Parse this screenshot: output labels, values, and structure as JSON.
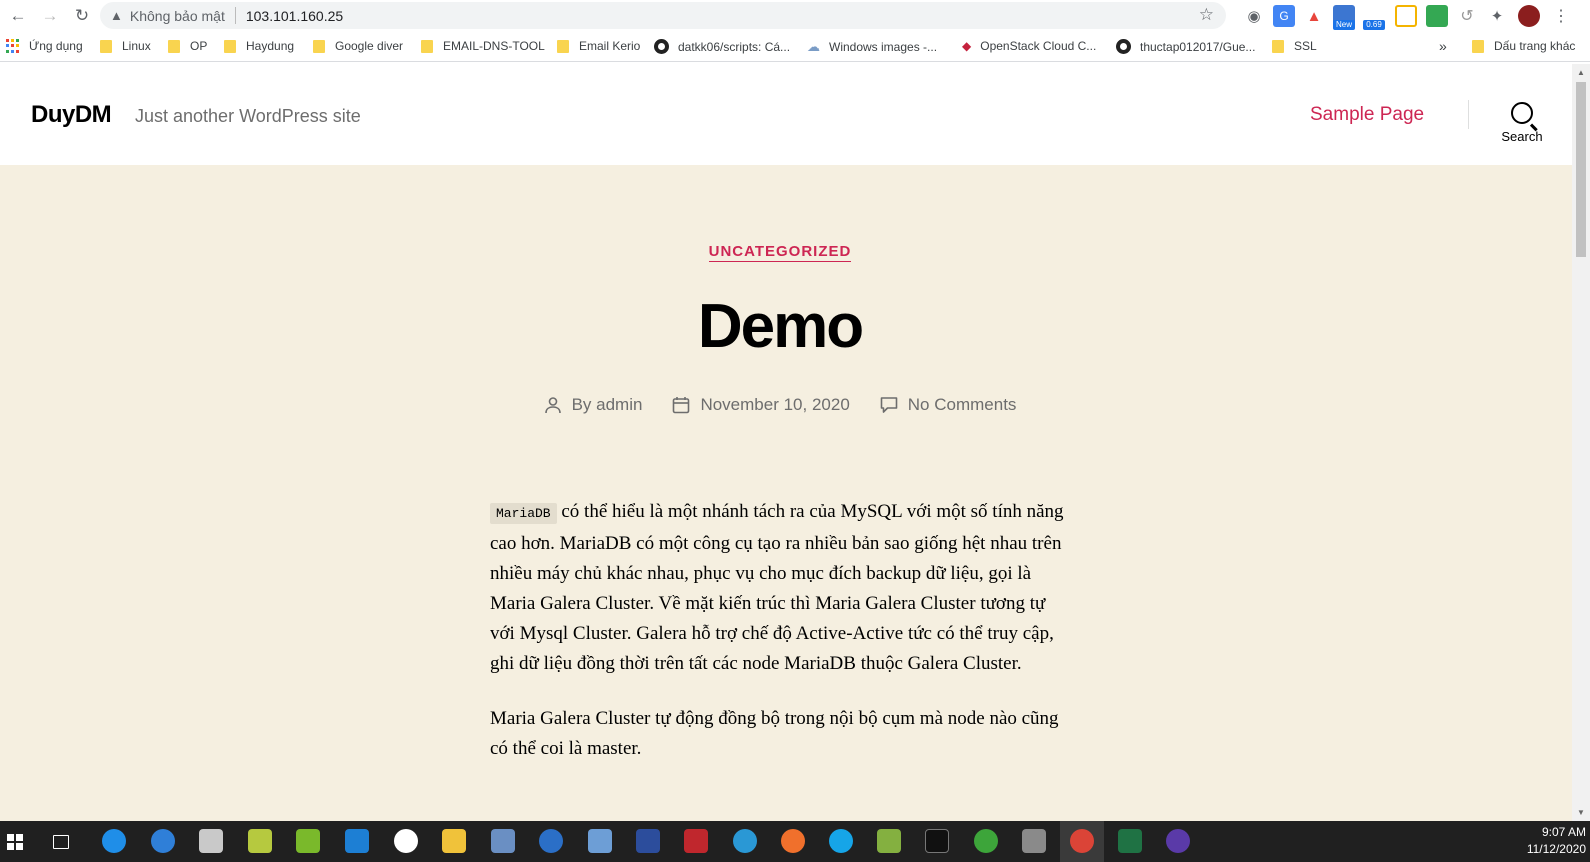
{
  "browser": {
    "security_text": "Không bảo mật",
    "url": "103.101.160.25",
    "ext_new_badge": "New",
    "ext_counter_badge": "0.69"
  },
  "bookmarks": {
    "apps": "Ứng dụng",
    "items": [
      "Linux",
      "OP",
      "Haydung",
      "Google diver",
      "EMAIL-DNS-TOOL",
      "Email Kerio",
      "datkk06/scripts: Cá...",
      "Windows images -...",
      "OpenStack Cloud C...",
      "thuctap012017/Gue...",
      "SSL"
    ],
    "overflow": "»",
    "other": "Dấu trang khác"
  },
  "site": {
    "title": "DuyDM",
    "description": "Just another WordPress site",
    "nav_item": "Sample Page",
    "search_label": "Search"
  },
  "post": {
    "category": "UNCATEGORIZED",
    "title": "Demo",
    "author": "By admin",
    "date": "November 10, 2020",
    "comments": "No Comments",
    "code": "MariaDB",
    "paragraph1_rest": " có thể hiểu là một nhánh tách ra của MySQL với một số tính năng cao hơn. MariaDB có một công cụ tạo ra nhiều bản sao giống hệt nhau trên nhiều máy chủ khác nhau, phục vụ cho mục đích backup dữ liệu, gọi là Maria Galera Cluster. Về mặt kiến trúc thì Maria Galera Cluster tương tự với Mysql Cluster. Galera hỗ trợ chế độ Active-Active tức có thể truy cập, ghi dữ liệu đồng thời trên tất các node MariaDB thuộc Galera Cluster.",
    "paragraph2": "Maria Galera Cluster tự động đồng bộ trong nội bộ cụm mà node nào cũng có thể coi là master."
  },
  "taskbar": {
    "time": "9:07 AM",
    "date": "11/12/2020"
  },
  "colors": {
    "accent": "#cd2653",
    "content_bg": "#f5efe0"
  }
}
